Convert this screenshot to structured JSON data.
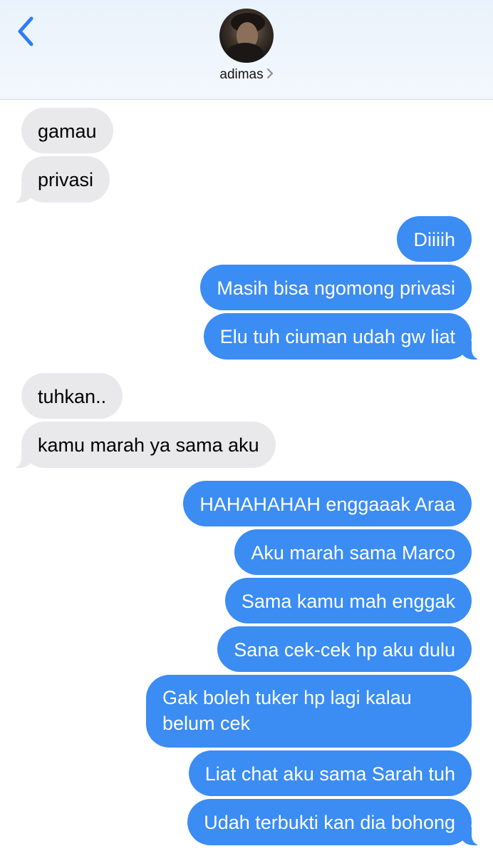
{
  "header": {
    "back_icon": "chevron-left-icon",
    "contact_name": "adimas",
    "contact_chevron_icon": "chevron-right-icon",
    "accent_color": "#2f7cf6"
  },
  "colors": {
    "incoming_bubble": "#e9e9eb",
    "outgoing_bubble": "#3b8cf3"
  },
  "messages": [
    {
      "direction": "incoming",
      "text": "gamau"
    },
    {
      "direction": "incoming",
      "text": "privasi"
    },
    {
      "direction": "outgoing",
      "text": "Diiiih"
    },
    {
      "direction": "outgoing",
      "text": "Masih bisa ngomong privasi"
    },
    {
      "direction": "outgoing",
      "text": "Elu tuh ciuman udah gw liat"
    },
    {
      "direction": "incoming",
      "text": "tuhkan.."
    },
    {
      "direction": "incoming",
      "text": "kamu marah ya sama aku"
    },
    {
      "direction": "outgoing",
      "text": "HAHAHAHAH enggaaak Araa"
    },
    {
      "direction": "outgoing",
      "text": "Aku marah sama Marco"
    },
    {
      "direction": "outgoing",
      "text": "Sama kamu mah enggak"
    },
    {
      "direction": "outgoing",
      "text": "Sana cek-cek hp aku dulu"
    },
    {
      "direction": "outgoing",
      "text": "Gak boleh tuker hp lagi kalau belum cek"
    },
    {
      "direction": "outgoing",
      "text": "Liat chat aku sama Sarah tuh"
    },
    {
      "direction": "outgoing",
      "text": "Udah terbukti kan dia bohong"
    }
  ]
}
